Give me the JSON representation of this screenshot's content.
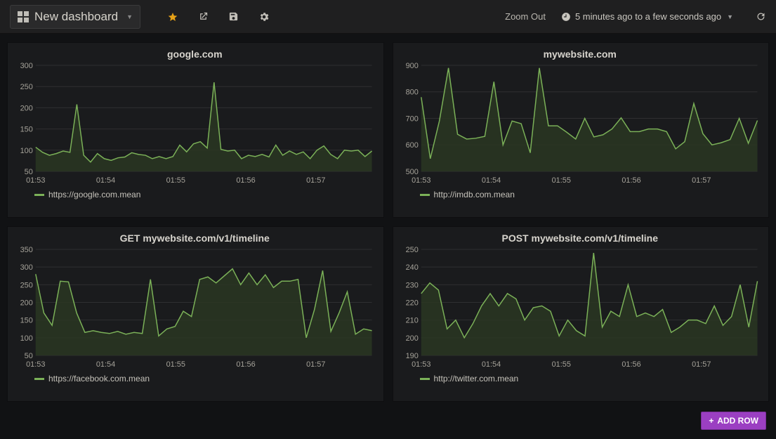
{
  "header": {
    "dashboard_title": "New dashboard",
    "zoom_out_label": "Zoom Out",
    "time_range_label": "5 minutes ago to a few seconds ago"
  },
  "footer": {
    "add_row_label": "ADD ROW"
  },
  "chart_data": [
    {
      "type": "line",
      "title": "google.com",
      "xlabel": "",
      "ylabel": "",
      "ylim": [
        50,
        300
      ],
      "yticks": [
        50,
        100,
        150,
        200,
        250,
        300
      ],
      "xticks": [
        "01:53",
        "01:54",
        "01:55",
        "01:56",
        "01:57"
      ],
      "series": [
        {
          "name": "https://google.com.mean",
          "values": [
            107,
            95,
            88,
            92,
            98,
            95,
            208,
            88,
            72,
            92,
            80,
            76,
            82,
            84,
            94,
            90,
            88,
            80,
            85,
            80,
            85,
            112,
            96,
            115,
            120,
            105,
            260,
            102,
            98,
            100,
            80,
            88,
            85,
            90,
            84,
            112,
            88,
            98,
            90,
            96,
            80,
            100,
            110,
            90,
            80,
            100,
            98,
            100,
            85,
            98
          ]
        }
      ]
    },
    {
      "type": "line",
      "title": "mywebsite.com",
      "xlabel": "",
      "ylabel": "",
      "ylim": [
        500,
        900
      ],
      "yticks": [
        500,
        600,
        700,
        800,
        900
      ],
      "xticks": [
        "01:53",
        "01:54",
        "01:55",
        "01:56",
        "01:57"
      ],
      "series": [
        {
          "name": "http://imdb.com.mean",
          "values": [
            780,
            548,
            690,
            890,
            640,
            622,
            625,
            632,
            838,
            600,
            690,
            680,
            570,
            890,
            672,
            672,
            648,
            622,
            700,
            630,
            638,
            660,
            702,
            650,
            650,
            660,
            660,
            650,
            585,
            612,
            756,
            642,
            600,
            608,
            620,
            700,
            606,
            692
          ]
        }
      ]
    },
    {
      "type": "line",
      "title": "GET mywebsite.com/v1/timeline",
      "xlabel": "",
      "ylabel": "",
      "ylim": [
        50,
        350
      ],
      "yticks": [
        50,
        100,
        150,
        200,
        250,
        300,
        350
      ],
      "xticks": [
        "01:53",
        "01:54",
        "01:55",
        "01:56",
        "01:57"
      ],
      "series": [
        {
          "name": "https://facebook.com.mean",
          "values": [
            280,
            170,
            135,
            260,
            258,
            170,
            115,
            120,
            115,
            112,
            118,
            110,
            115,
            112,
            265,
            105,
            125,
            132,
            175,
            160,
            265,
            272,
            255,
            275,
            295,
            250,
            283,
            250,
            278,
            242,
            260,
            260,
            265,
            100,
            180,
            290,
            118,
            170,
            230,
            110,
            125,
            120
          ]
        }
      ]
    },
    {
      "type": "line",
      "title": "POST mywebsite.com/v1/timeline",
      "xlabel": "",
      "ylabel": "",
      "ylim": [
        190,
        250
      ],
      "yticks": [
        190,
        200,
        210,
        220,
        230,
        240,
        250
      ],
      "xticks": [
        "01:53",
        "01:54",
        "01:55",
        "01:56",
        "01:57"
      ],
      "series": [
        {
          "name": "http://twitter.com.mean",
          "values": [
            225,
            231,
            227,
            205,
            210,
            200,
            208,
            218,
            225,
            218,
            225,
            222,
            210,
            217,
            218,
            215,
            201,
            210,
            204,
            201,
            248,
            206,
            215,
            212,
            230,
            212,
            214,
            212,
            216,
            203,
            206,
            210,
            210,
            208,
            218,
            207,
            212,
            230,
            206,
            232
          ]
        }
      ]
    }
  ]
}
